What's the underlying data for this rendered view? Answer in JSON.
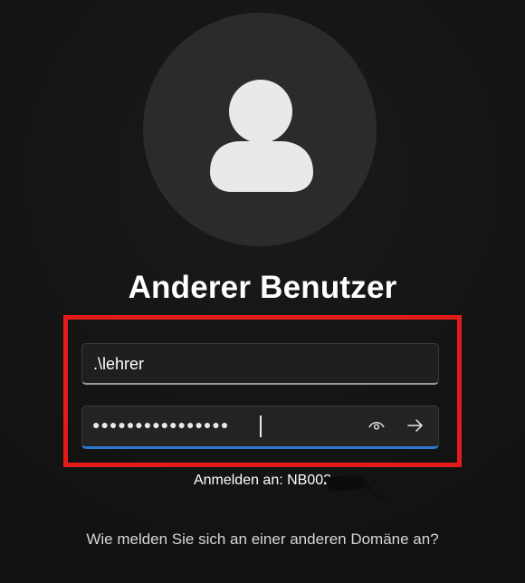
{
  "user": {
    "title": "Anderer Benutzer"
  },
  "form": {
    "username_value": ".\\lehrer",
    "password_mask": "●●●●●●●●●●●●●●●●"
  },
  "signin": {
    "label": "Anmelden an: NB002"
  },
  "links": {
    "other_domain": "Wie melden Sie sich an einer anderen Domäne an?"
  },
  "icons": {
    "avatar": "user-silhouette-icon",
    "reveal": "eye-icon",
    "submit": "arrow-right-icon"
  },
  "colors": {
    "highlight": "#e31b1b",
    "focus_underline": "#2b79d1",
    "background": "#131313"
  }
}
